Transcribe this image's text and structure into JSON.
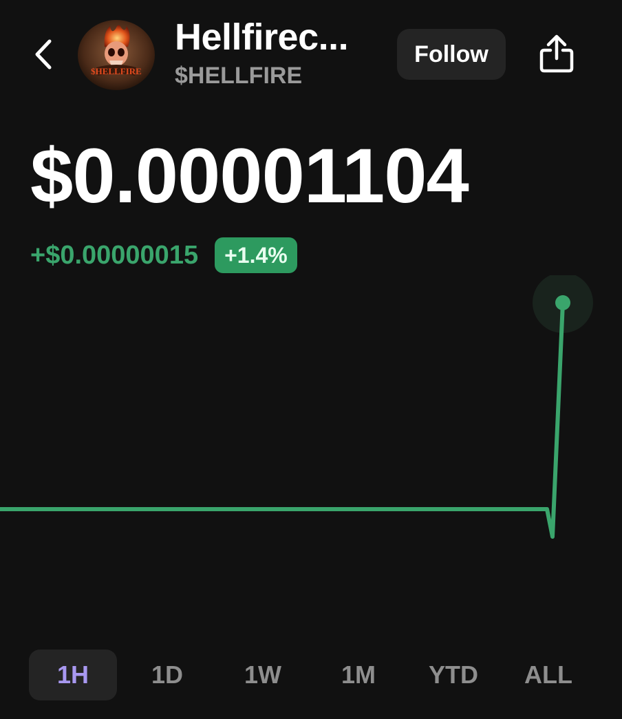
{
  "header": {
    "token_name": "Hellfirec...",
    "ticker": "$HELLFIRE",
    "follow_label": "Follow",
    "avatar_text": "$HELLFIRE"
  },
  "price": {
    "value": "$0.00001104",
    "change_abs": "+$0.00000015",
    "change_pct": "+1.4%"
  },
  "colors": {
    "background": "#111111",
    "positive": "#3aa56c",
    "badge": "#2d9a5f",
    "active_tab": "#a898f0"
  },
  "chart_data": {
    "type": "line",
    "series": [
      {
        "values": [
          1.089e-05,
          1.089e-05,
          1.089e-05,
          1.089e-05,
          1.089e-05,
          1.089e-05,
          1.089e-05,
          1.089e-05,
          1.089e-05,
          1.089e-05,
          1.087e-05,
          1.104e-05
        ]
      }
    ],
    "ylim": [
      1.08e-05,
      1.106e-05
    ],
    "grid": false
  },
  "tabs": [
    {
      "label": "1H",
      "active": true
    },
    {
      "label": "1D",
      "active": false
    },
    {
      "label": "1W",
      "active": false
    },
    {
      "label": "1M",
      "active": false
    },
    {
      "label": "YTD",
      "active": false
    },
    {
      "label": "ALL",
      "active": false
    }
  ]
}
